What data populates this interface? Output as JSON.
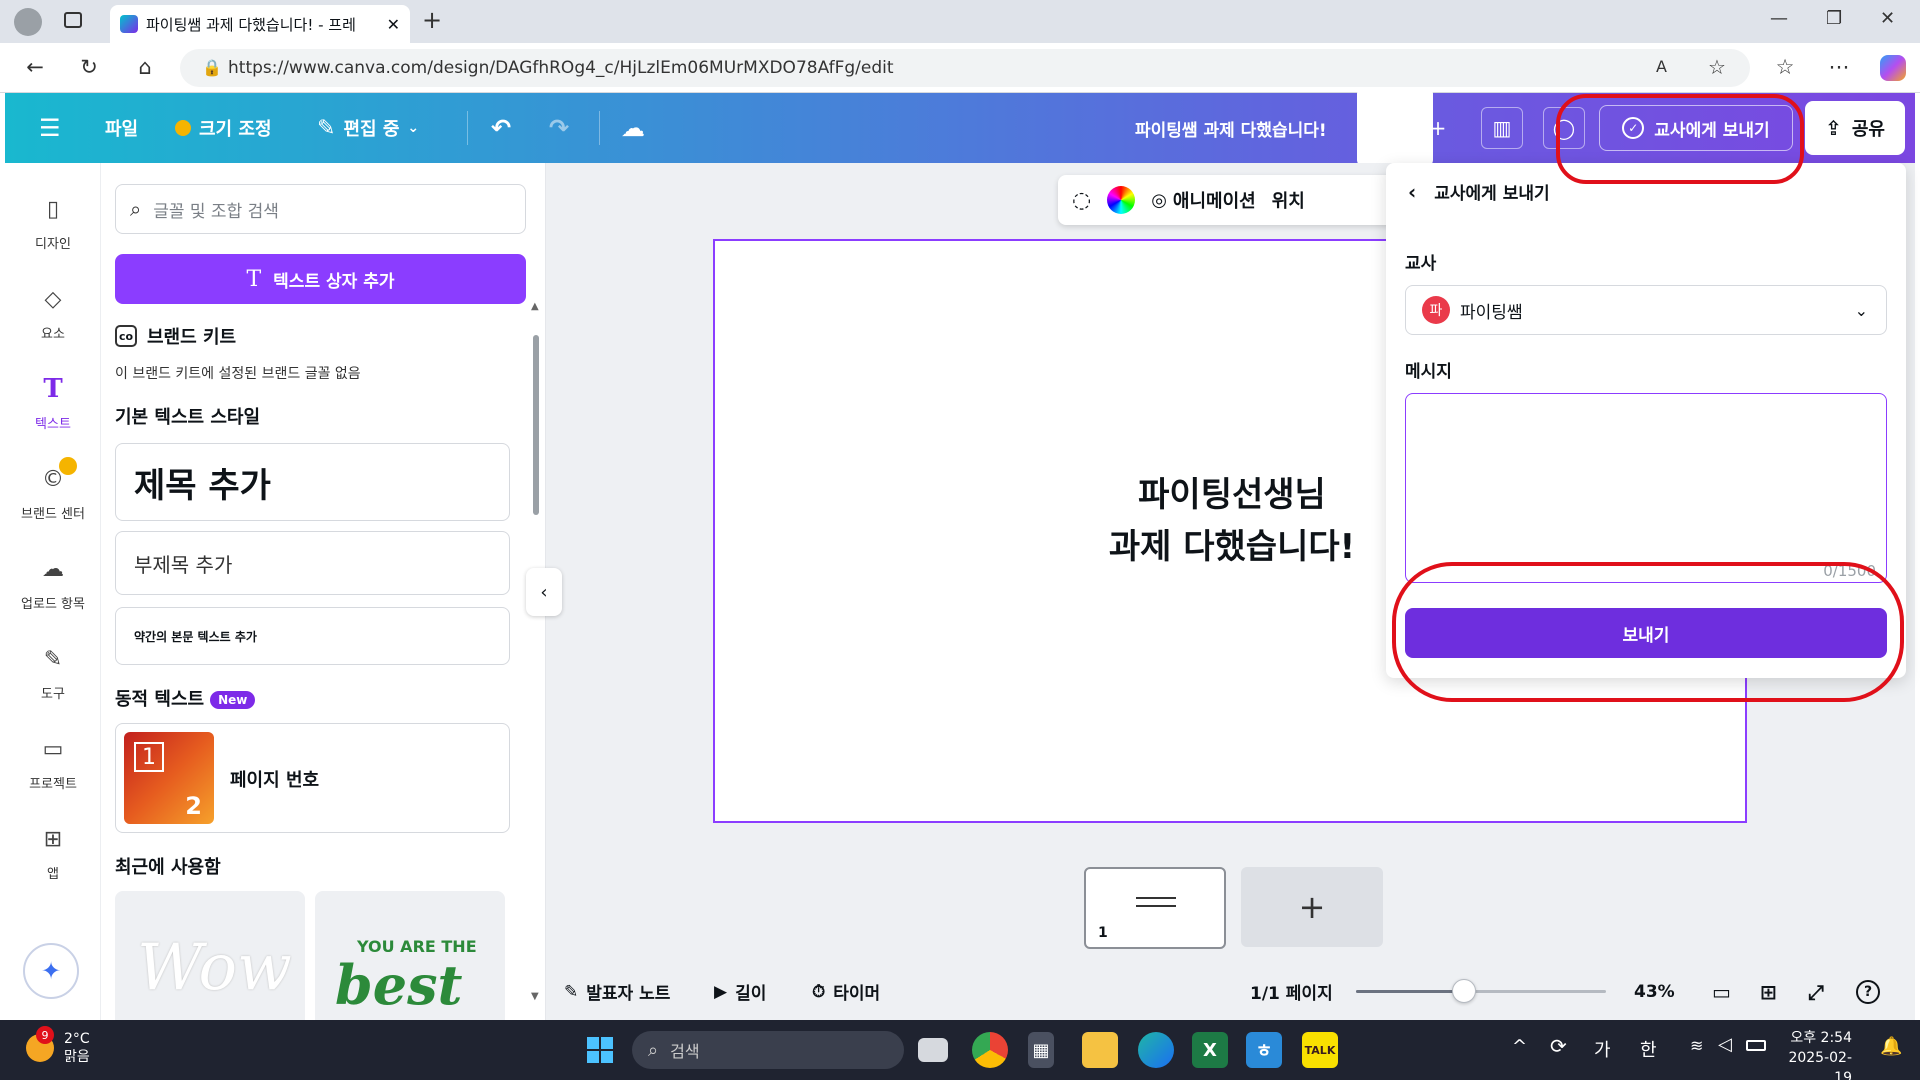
{
  "browser": {
    "tab_title": "파이팅쌤 과제 다했습니다! - 프레",
    "url": "https://www.canva.com/design/DAGfhROg4_c/HjLzlEm06MUrMXDO78AfFg/edit"
  },
  "header": {
    "file_label": "파일",
    "resize_label": "크기 조정",
    "editing_label": "편집 중",
    "doc_title": "파이팅쌤 과제 다했습니다!",
    "send_teacher_label": "교사에게 보내기",
    "share_label": "공유"
  },
  "rail": {
    "items": [
      {
        "label": "디자인",
        "icon": "layout-icon"
      },
      {
        "label": "요소",
        "icon": "elements-icon"
      },
      {
        "label": "텍스트",
        "icon": "text-icon"
      },
      {
        "label": "브랜드 센터",
        "icon": "brand-icon"
      },
      {
        "label": "업로드 항목",
        "icon": "upload-icon"
      },
      {
        "label": "도구",
        "icon": "pen-icon"
      },
      {
        "label": "프로젝트",
        "icon": "folder-icon"
      },
      {
        "label": "앱",
        "icon": "apps-icon"
      }
    ]
  },
  "panel": {
    "search_placeholder": "글꼴 및 조합 검색",
    "add_textbox": "텍스트 상자 추가",
    "brand_kit_title": "브랜드 키트",
    "brand_kit_note": "이 브랜드 키트에 설정된 브랜드 글꼴 없음",
    "default_styles_title": "기본 텍스트 스타일",
    "heading": "제목 추가",
    "subheading": "부제목 추가",
    "body": "약간의 본문 텍스트 추가",
    "dynamic_title": "동적 텍스트",
    "new_badge": "New",
    "page_number_label": "페이지 번호",
    "page_number_digit1": "1",
    "page_number_digit2": "2",
    "recent_title": "최근에 사용함",
    "recent_1": "Wow",
    "recent_2_top": "YOU ARE THE",
    "recent_2_main": "best"
  },
  "canvas": {
    "toolbar_animation": "애니메이션",
    "toolbar_position": "위치",
    "design_line1": "파이팅선생님",
    "design_line2": "과제 다했습니다!",
    "thumb_page": "1",
    "notes": "발표자 노트",
    "duration": "길이",
    "timer": "타이머",
    "page_count": "1/1 페이지",
    "zoom_value": 0.43,
    "zoom_label": "43%"
  },
  "send_panel": {
    "title": "교사에게 보내기",
    "teacher_label": "교사",
    "teacher_avatar": "파",
    "teacher_name": "파이팅쌤",
    "message_label": "메시지",
    "char_count": "0/1500",
    "send_button": "보내기"
  },
  "taskbar": {
    "weather_temp": "2°C",
    "weather_desc": "맑음",
    "weather_badge": "9",
    "search_placeholder": "검색",
    "ime_1": "가",
    "ime_2": "한",
    "time": "오후 2:54",
    "date": "2025-02-19"
  },
  "colors": {
    "brand_purple": "#8b3dff",
    "send_button": "#6e2ede",
    "annotation_red": "#e0101a"
  }
}
